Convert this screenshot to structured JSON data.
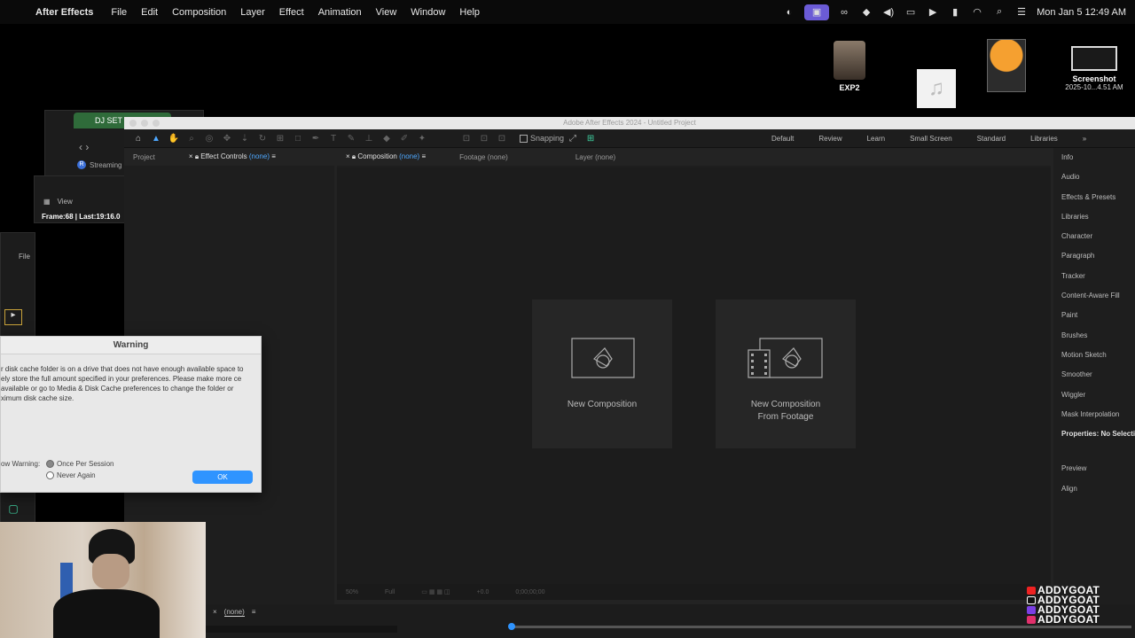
{
  "menubar": {
    "app_name": "After Effects",
    "items": [
      "File",
      "Edit",
      "Composition",
      "Layer",
      "Effect",
      "Animation",
      "View",
      "Window",
      "Help"
    ],
    "clock": "Mon Jan 5  12:49 AM"
  },
  "desktop": {
    "exp2_label": "EXP2",
    "screenshot_label": "Screenshot",
    "screenshot_sublabel": "2025-10...4.51 AM"
  },
  "background_windows": {
    "djset_tab": "DJ SET",
    "streaming_label": "Streaming",
    "view_menu": "View",
    "frame_info": "Frame:68 | Last:19:16.0",
    "file_menu": "File"
  },
  "ae": {
    "window_title": "Adobe After Effects 2024 - Untitled Project",
    "snapping_label": "Snapping",
    "workspaces": [
      "Default",
      "Review",
      "Learn",
      "Small Screen",
      "Standard",
      "Libraries"
    ],
    "left_tabs": {
      "project": "Project",
      "effect_controls": "Effect Controls",
      "effect_controls_none": "(none)"
    },
    "comp_tabs": {
      "composition": "Composition",
      "composition_none": "(none)",
      "footage": "Footage (none)",
      "layer": "Layer (none)"
    },
    "cards": {
      "new_comp": "New Composition",
      "new_comp_footage_line1": "New Composition",
      "new_comp_footage_line2": "From Footage"
    },
    "comp_footer": {
      "zoom": "50%",
      "resolution": "Full",
      "exposure": "+0.0",
      "timecode": "0;00;00;00"
    },
    "right_panel": [
      "Info",
      "Audio",
      "Effects & Presets",
      "Libraries",
      "Character",
      "Paragraph",
      "Tracker",
      "Content-Aware Fill",
      "Paint",
      "Brushes",
      "Motion Sketch",
      "Smoother",
      "Wiggler",
      "Mask Interpolation"
    ],
    "properties_label": "Properties: No Selection",
    "right_panel_bottom": [
      "Preview",
      "Align"
    ],
    "timeline_tab": "(none)"
  },
  "warning": {
    "title": "Warning",
    "message": "r disk cache folder is on a drive that does not have enough available space to ely store the full amount specified in your preferences. Please make more ce available or go to Media & Disk Cache preferences to change the folder or ximum disk cache size.",
    "show_warning": "ow Warning:",
    "option_once": "Once Per Session",
    "option_never": "Never Again",
    "ok": "OK"
  },
  "watermark": [
    "ADDYGOAT",
    "ADDYGOAT",
    "ADDYGOAT",
    "ADDYGOAT"
  ],
  "colors": {
    "accent": "#2f94ff",
    "highlight": "#4ea8ff",
    "menubar_active": "#6b5bd6"
  }
}
